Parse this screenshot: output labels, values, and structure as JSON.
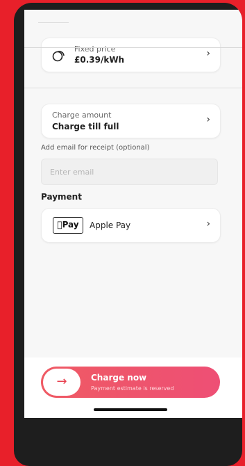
{
  "pricing": {
    "label": "Fixed price",
    "value": "£0.39/kWh",
    "icon": "price-tag-icon"
  },
  "charge": {
    "label": "Charge amount",
    "value": "Charge till full"
  },
  "email": {
    "label": "Add email for receipt (optional)",
    "placeholder": "Enter email",
    "value": ""
  },
  "payment": {
    "title": "Payment",
    "method_logo": "Pay",
    "method_name": "Apple Pay"
  },
  "cta": {
    "title": "Charge now",
    "subtitle": "Payment estimate is reserved",
    "icon": "arrow-right-icon"
  },
  "colors": {
    "background": "#e8202a",
    "accent": "#ee5268",
    "phone_frame": "#1e1e1e"
  }
}
